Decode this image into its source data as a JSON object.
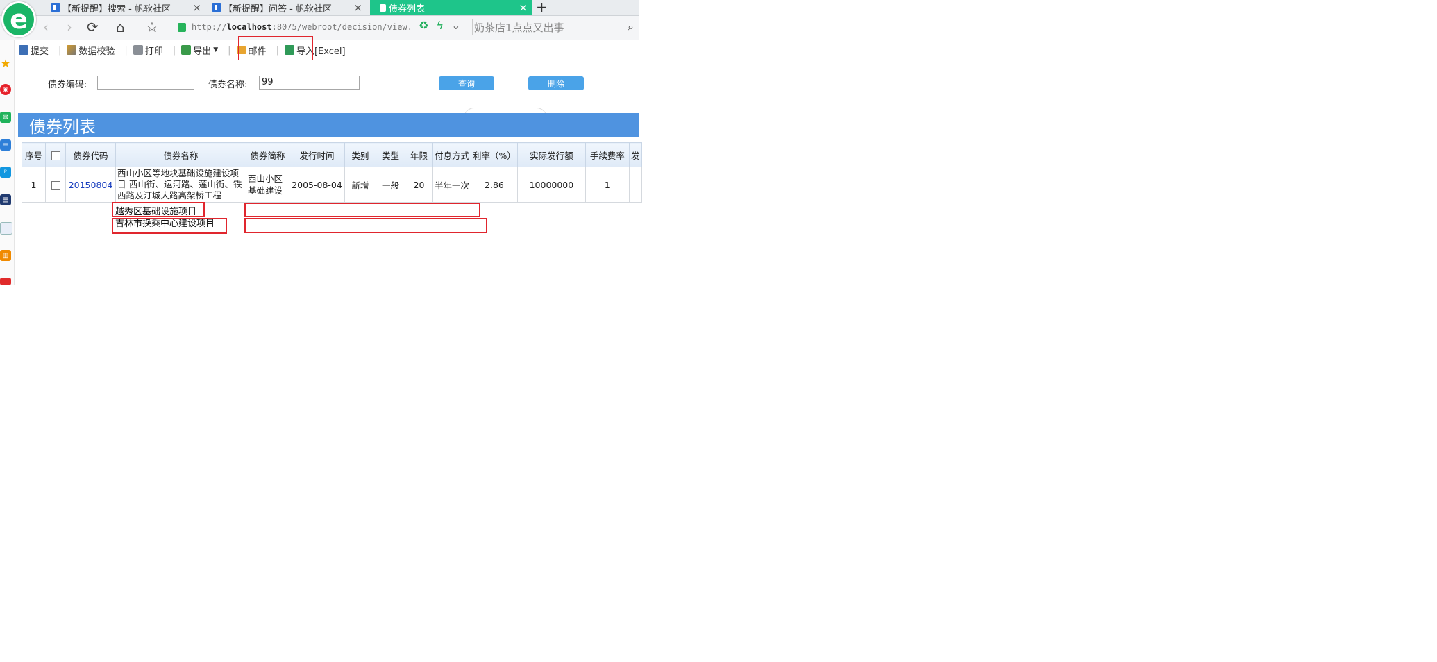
{
  "browser": {
    "tabs": [
      {
        "title": "【新提醒】搜索 - 帆软社区",
        "active": false
      },
      {
        "title": "【新提醒】问答 - 帆软社区",
        "active": false
      },
      {
        "title": "债券列表",
        "active": true
      }
    ],
    "new_tab_label": "+",
    "close_label": "×",
    "address_prefix": "http://",
    "address_host": "localhost",
    "address_rest": ":8075/webroot/decision/view.",
    "search_placeholder": "奶茶店1点点又出事",
    "logo_letter": "e"
  },
  "toolbar": {
    "items": [
      {
        "label": "提交",
        "icon": "save-icon"
      },
      {
        "label": "数据校验",
        "icon": "check-icon"
      },
      {
        "label": "打印",
        "icon": "print-icon"
      },
      {
        "label": "导出",
        "icon": "export-icon"
      },
      {
        "label": "邮件",
        "icon": "mail-icon"
      },
      {
        "label": "导入[Excel]",
        "icon": "excel-icon"
      }
    ]
  },
  "form": {
    "code_label": "债券编码:",
    "code_value": "",
    "name_label": "债券名称:",
    "name_value": "99",
    "query_button": "查询",
    "delete_button": "删除"
  },
  "page_title": "债券列表",
  "table": {
    "headers": [
      "序号",
      "",
      "债券代码",
      "债券名称",
      "债券简称",
      "发行时间",
      "类别",
      "类型",
      "年限",
      "付息方式",
      "利率（%）",
      "实际发行额",
      "手续费率",
      "发"
    ],
    "row": {
      "index": "1",
      "code": "20150804",
      "name": "西山小区等地块基础设施建设项目-西山街、运河路、莲山街、铁西路及汀城大路高架桥工程",
      "short_name": "西山小区基础建设",
      "issue_date": "2005-08-04",
      "category": "新增",
      "type": "一般",
      "years": "20",
      "payment": "半年一次",
      "rate": "2.86",
      "amount": "10000000",
      "fee_rate": "1"
    },
    "extra_lines": [
      "越秀区基础设施项目",
      "吉林市换乘中心建设项目"
    ]
  },
  "colors": {
    "title_bar": "#4f93e0",
    "button": "#4aa3e8",
    "highlight_box": "#e0262e",
    "active_tab": "#1ec58a"
  }
}
